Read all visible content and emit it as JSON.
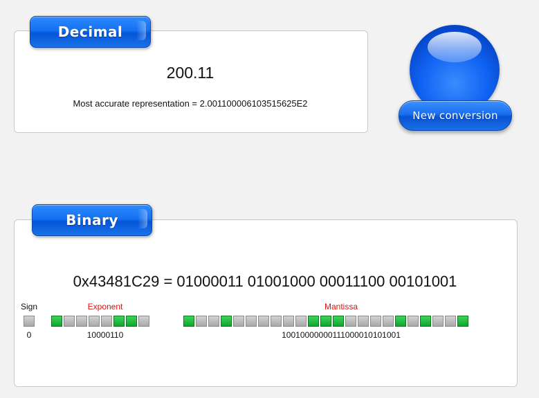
{
  "decimal_panel": {
    "tab_label": "Decimal",
    "value": "200.11",
    "accurate_text": "Most accurate representation = 2.001100006103515625E2"
  },
  "new_conversion_label": "New conversion",
  "binary_panel": {
    "tab_label": "Binary",
    "hex_line": "0x43481C29 = 01000011 01001000 00011100 00101001",
    "sign": {
      "label": "Sign",
      "bits": [
        0
      ],
      "value": "0"
    },
    "exponent": {
      "label": "Exponent",
      "bits": [
        1,
        0,
        0,
        0,
        0,
        1,
        1,
        0
      ],
      "value": "10000110"
    },
    "mantissa": {
      "label": "Mantissa",
      "bits": [
        1,
        0,
        0,
        1,
        0,
        0,
        0,
        0,
        0,
        0,
        1,
        1,
        1,
        0,
        0,
        0,
        0,
        1,
        0,
        1,
        0,
        0,
        1
      ],
      "value": "10010000000111000010101001"
    }
  },
  "colors": {
    "accent_blue": "#1571f0",
    "bit_on": "#10a52c",
    "bit_off": "#a9a9a9",
    "exponent_label": "#e01010",
    "mantissa_label": "#e01010"
  }
}
